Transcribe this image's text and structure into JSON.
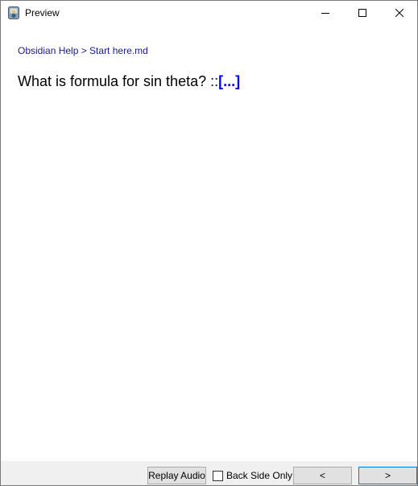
{
  "window": {
    "title": "Preview",
    "icon": "app-icon"
  },
  "breadcrumb": {
    "text": "Obsidian Help > Start here.md"
  },
  "card": {
    "question": "What is formula for sin theta? ::",
    "cloze": "[...]"
  },
  "toolbar": {
    "replay_label": "Replay Audio",
    "back_only_label": "Back Side Only",
    "back_only_checked": false,
    "prev_label": "<",
    "next_label": ">"
  },
  "colors": {
    "breadcrumb": "#1a1a8c",
    "cloze": "#0000ff",
    "focus_border": "#0078d7",
    "bottom_bar": "#f0f0f0"
  }
}
